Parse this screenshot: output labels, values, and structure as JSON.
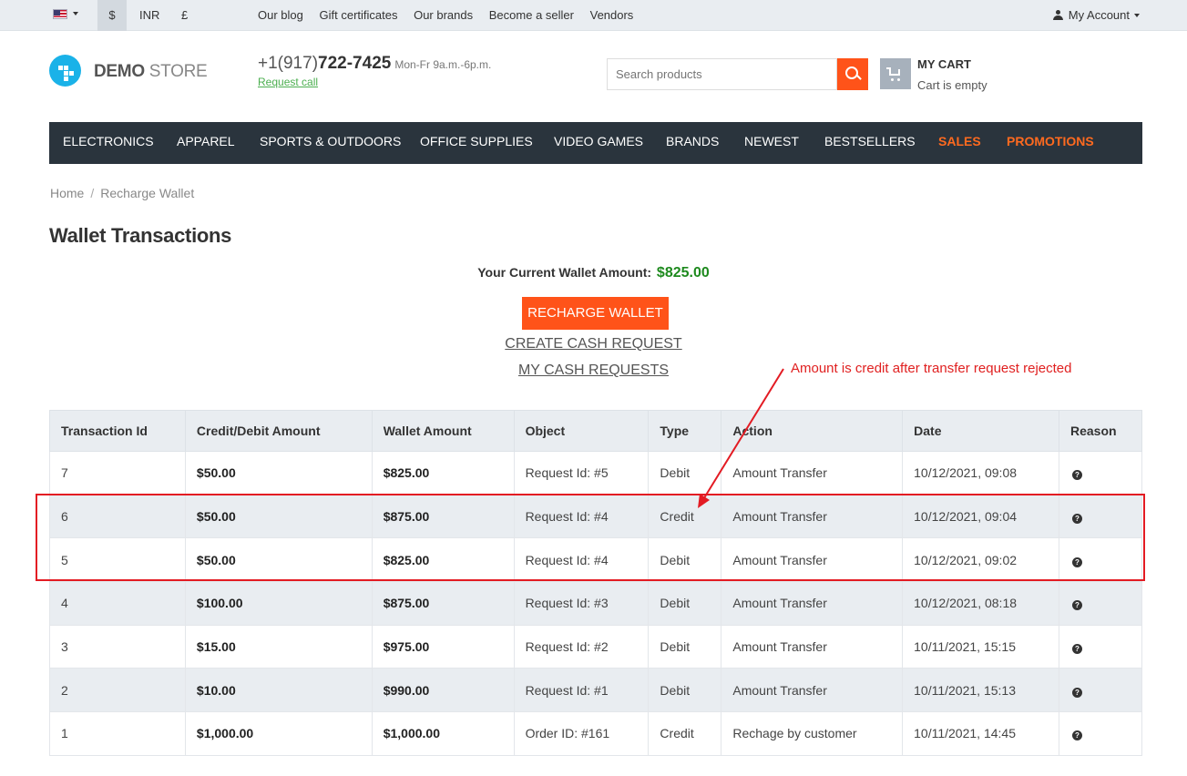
{
  "topbar": {
    "currency": {
      "usd": "$",
      "inr": "INR",
      "gbp": "£"
    },
    "links": [
      "Our blog",
      "Gift certificates",
      "Our brands",
      "Become a seller",
      "Vendors"
    ],
    "account_label": "My Account"
  },
  "header": {
    "logo_bold": "DEMO",
    "logo_light": "STORE",
    "phone_prefix": "+1(917)",
    "phone_number": "722-7425",
    "hours": "Mon-Fr 9a.m.-6p.m.",
    "request_call": "Request call",
    "search_placeholder": "Search products",
    "cart_title": "MY CART",
    "cart_status": "Cart is empty"
  },
  "nav": {
    "items": [
      "ELECTRONICS",
      "APPAREL",
      "SPORTS & OUTDOORS",
      "OFFICE SUPPLIES",
      "VIDEO GAMES",
      "BRANDS",
      "NEWEST",
      "BESTSELLERS",
      "SALES",
      "PROMOTIONS"
    ],
    "accent_color": "#ff6a1f"
  },
  "breadcrumb": {
    "home": "Home",
    "current": "Recharge Wallet"
  },
  "page_title": "Wallet Transactions",
  "wallet": {
    "label": "Your Current Wallet Amount:",
    "amount": "$825.00",
    "recharge_button": "RECHARGE WALLET",
    "create_cash_request": "CREATE CASH REQUEST",
    "my_cash_requests": "MY CASH REQUESTS"
  },
  "annotation": {
    "text": "Amount is credit after transfer request rejected",
    "color": "#e02020"
  },
  "table": {
    "headers": [
      "Transaction Id",
      "Credit/Debit Amount",
      "Wallet Amount",
      "Object",
      "Type",
      "Action",
      "Date",
      "Reason"
    ],
    "rows": [
      {
        "id": "7",
        "amount": "$50.00",
        "wallet": "$825.00",
        "object": "Request Id: #5",
        "type": "Debit",
        "action": "Amount Transfer",
        "date": "10/12/2021, 09:08"
      },
      {
        "id": "6",
        "amount": "$50.00",
        "wallet": "$875.00",
        "object": "Request Id: #4",
        "type": "Credit",
        "action": "Amount Transfer",
        "date": "10/12/2021, 09:04"
      },
      {
        "id": "5",
        "amount": "$50.00",
        "wallet": "$825.00",
        "object": "Request Id: #4",
        "type": "Debit",
        "action": "Amount Transfer",
        "date": "10/12/2021, 09:02"
      },
      {
        "id": "4",
        "amount": "$100.00",
        "wallet": "$875.00",
        "object": "Request Id: #3",
        "type": "Debit",
        "action": "Amount Transfer",
        "date": "10/12/2021, 08:18"
      },
      {
        "id": "3",
        "amount": "$15.00",
        "wallet": "$975.00",
        "object": "Request Id: #2",
        "type": "Debit",
        "action": "Amount Transfer",
        "date": "10/11/2021, 15:15"
      },
      {
        "id": "2",
        "amount": "$10.00",
        "wallet": "$990.00",
        "object": "Request Id: #1",
        "type": "Debit",
        "action": "Amount Transfer",
        "date": "10/11/2021, 15:13"
      },
      {
        "id": "1",
        "amount": "$1,000.00",
        "wallet": "$1,000.00",
        "object": "Order ID: #161",
        "type": "Credit",
        "action": "Rechage by customer",
        "date": "10/11/2021, 14:45"
      }
    ],
    "reason_icon": "question-circle-icon"
  },
  "colors": {
    "brand_orange": "#ff5319",
    "credit_green": "#1e8a1e",
    "debit_red": "#e02020",
    "nav_bg": "#2a343d"
  }
}
